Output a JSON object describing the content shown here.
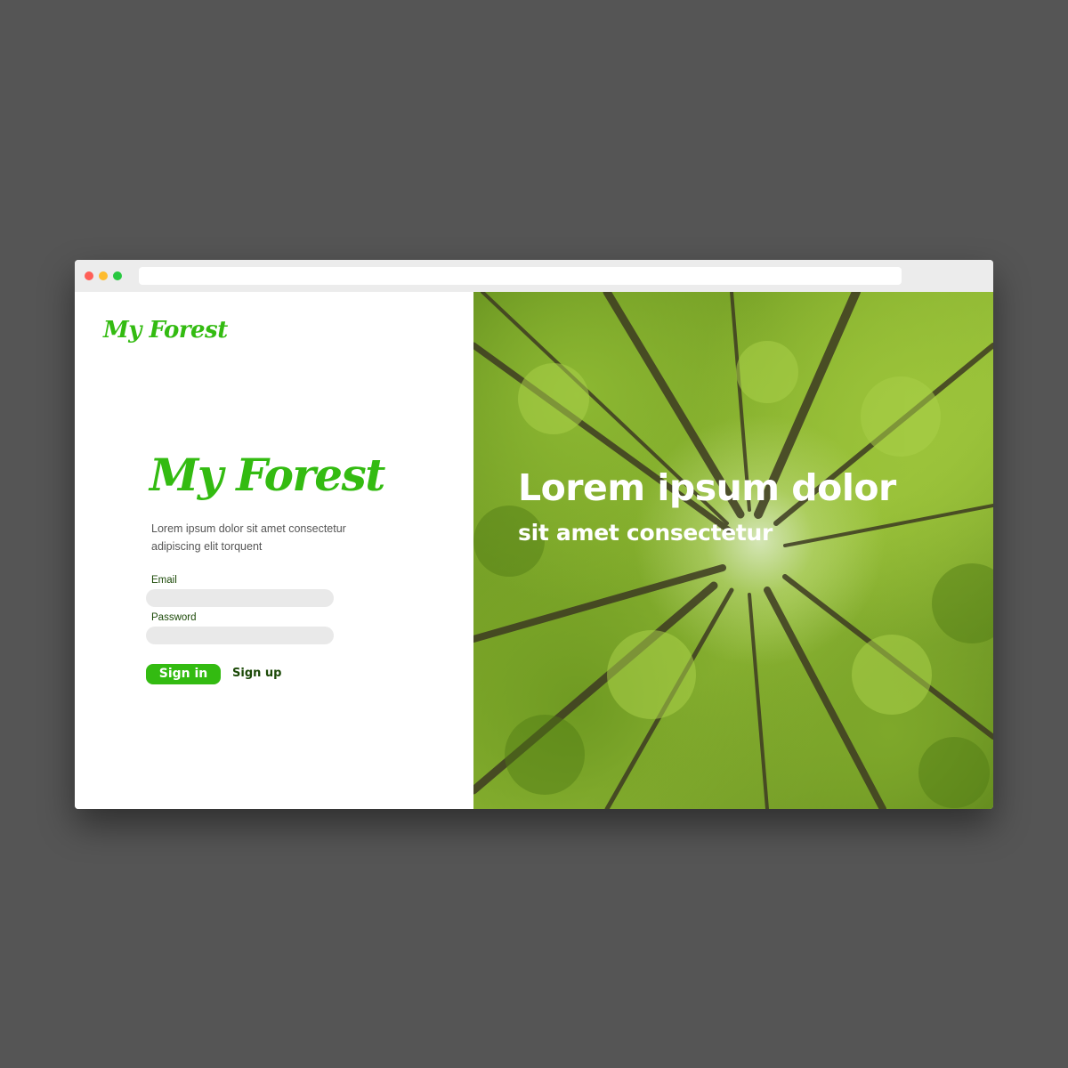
{
  "brand": {
    "logo_small": "My Forest",
    "logo_large": "My Forest",
    "color": "#33bb11"
  },
  "intro": {
    "description": "Lorem ipsum dolor sit amet consectetur adipiscing elit torquent"
  },
  "form": {
    "email_label": "Email",
    "email_value": "",
    "password_label": "Password",
    "password_value": "",
    "signin_label": "Sign in",
    "signup_label": "Sign up",
    "accent": "#33bb11",
    "label_color": "#1c4a08"
  },
  "hero": {
    "title": "Lorem ipsum dolor",
    "subtitle": "sit amet consectetur",
    "image": "forest-canopy-image"
  }
}
